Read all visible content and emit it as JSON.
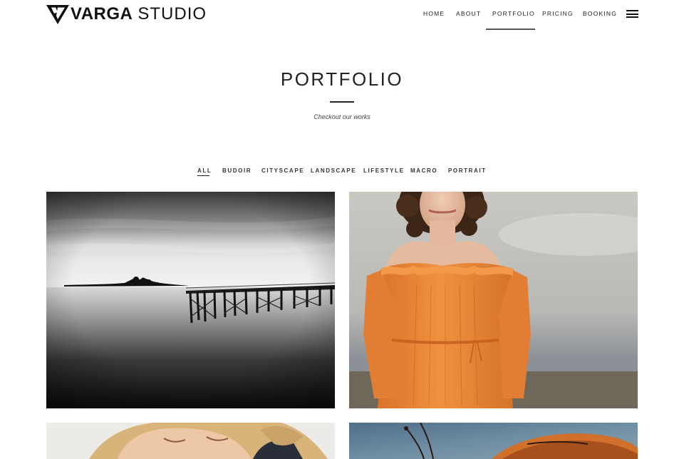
{
  "brand": {
    "name_bold": "VARGA",
    "name_light": "STUDIO",
    "logo_icon": "v-triangle-logo-icon"
  },
  "nav": {
    "items": [
      {
        "label": "HOME"
      },
      {
        "label": "ABOUT"
      },
      {
        "label": "PORTFOLIO",
        "active": true
      },
      {
        "label": "PRICING"
      },
      {
        "label": "BOOKING"
      }
    ],
    "menu_icon": "hamburger-menu-icon"
  },
  "hero": {
    "title": "PORTFOLIO",
    "subtitle": "Checkout our works"
  },
  "filters": [
    {
      "label": "ALL",
      "active": true
    },
    {
      "label": "BUDOIR"
    },
    {
      "label": "CITYSCAPE"
    },
    {
      "label": "LANDSCAPE"
    },
    {
      "label": "LIFESTYLE"
    },
    {
      "label": "MACRO"
    },
    {
      "label": "PORTRAIT"
    }
  ],
  "gallery": [
    {
      "subject": "black-and-white long exposure pier at sea"
    },
    {
      "subject": "woman in orange off-shoulder dress"
    },
    {
      "subject": "blonde woman portrait"
    },
    {
      "subject": "macro butterfly close-up"
    }
  ],
  "colors": {
    "text": "#222222",
    "background": "#ffffff",
    "dress_orange": "#e98a3a"
  }
}
